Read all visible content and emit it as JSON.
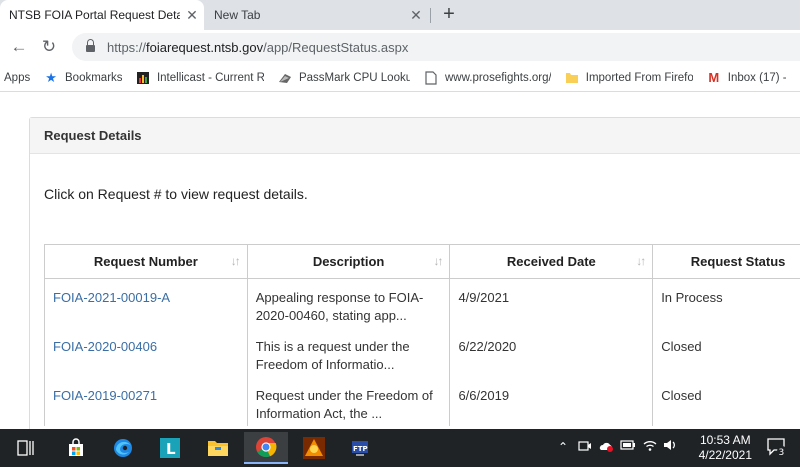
{
  "browser": {
    "tabs": [
      {
        "title": "NTSB FOIA Portal Request Detail",
        "close": "✕"
      },
      {
        "title": "New Tab",
        "close": "✕"
      }
    ],
    "new_tab": "+",
    "back": "←",
    "reload": "↻",
    "url_scheme": "https://",
    "url_host": "foiarequest.ntsb.gov",
    "url_path": "/app/RequestStatus.aspx"
  },
  "bookmarks": [
    {
      "label": "Apps",
      "icon": "apps-grid-icon"
    },
    {
      "label": "Bookmarks",
      "icon": "star-icon"
    },
    {
      "label": "Intellicast - Current R",
      "icon": "intellicast-icon"
    },
    {
      "label": "PassMark CPU Looku",
      "icon": "passmark-icon"
    },
    {
      "label": "www.prosefights.org/",
      "icon": "page-icon"
    },
    {
      "label": "Imported From Firefo",
      "icon": "folder-icon"
    },
    {
      "label": "Inbox (17) -",
      "icon": "gmail-icon"
    }
  ],
  "panel": {
    "heading": "Request Details",
    "instructions": "Click on Request # to view request details."
  },
  "table": {
    "columns": [
      "Request Number",
      "Description",
      "Received Date",
      "Request Status"
    ],
    "sort_icon": "↓↑",
    "rows": [
      {
        "number": "FOIA-2021-00019-A",
        "description_1": "Appealing response to FOIA-",
        "description_2": "2020-00460, stating app...",
        "date": "4/9/2021",
        "status": "In Process"
      },
      {
        "number": "FOIA-2020-00406",
        "description_1": "This is a request under the",
        "description_2": "Freedom of Informatio...",
        "date": "6/22/2020",
        "status": "Closed"
      },
      {
        "number": "FOIA-2019-00271",
        "description_1": "Request under the Freedom of",
        "description_2": "Information Act, the ...",
        "date": "6/6/2019",
        "status": "Closed"
      }
    ]
  },
  "taskbar": {
    "time": "10:53 AM",
    "date": "4/22/2021",
    "notifications": "3"
  }
}
